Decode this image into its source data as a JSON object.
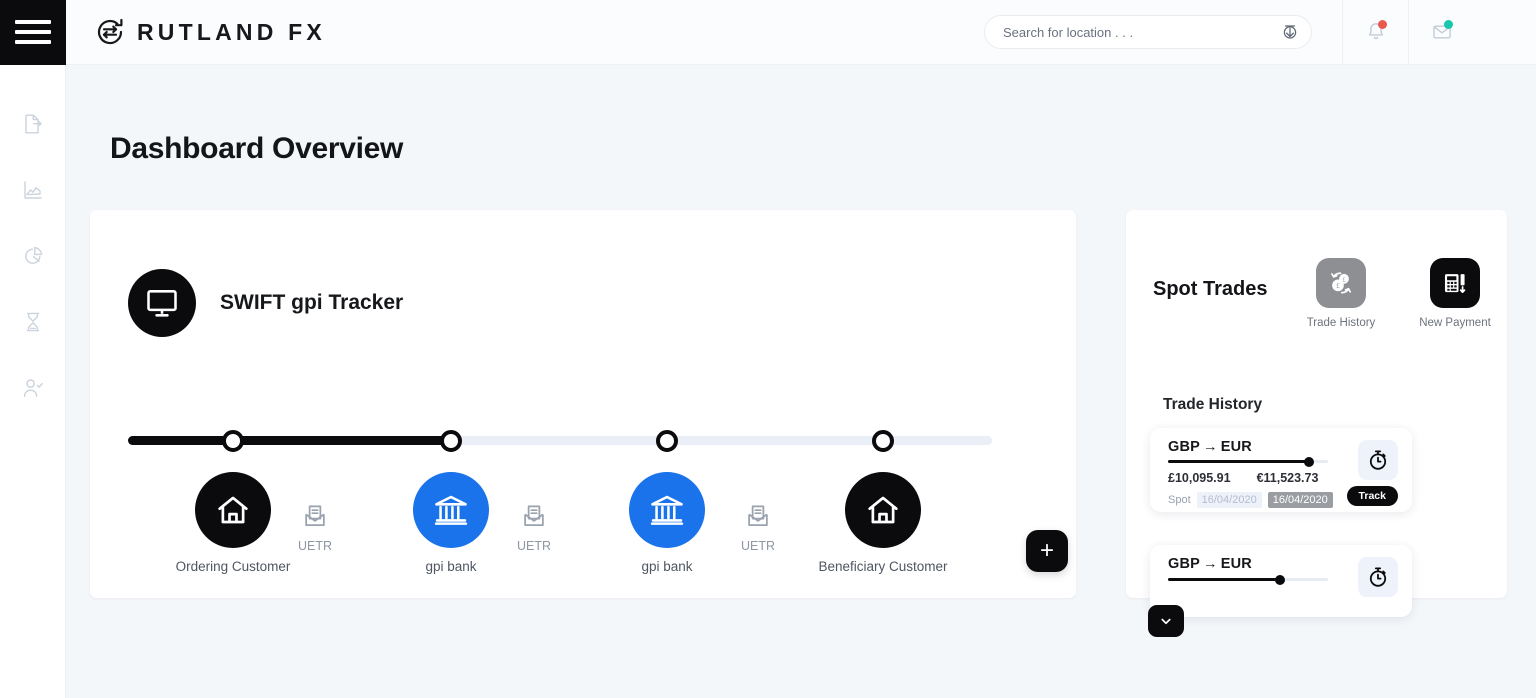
{
  "header": {
    "menu_icon": "hamburger-icon",
    "brand_name": "RUTLAND FX",
    "brand_icon": "exchange-circle-icon",
    "search": {
      "placeholder": "Search for location . . .",
      "value": "",
      "icon": "download-icon"
    },
    "notifications_icon": "bell-icon",
    "notifications_badge_color": "#e8584e",
    "messages_icon": "envelope-icon",
    "messages_badge_color": "#18c7ad"
  },
  "sidebar": {
    "items": [
      {
        "icon": "document-export-icon",
        "name": "sidebar-item-documents"
      },
      {
        "icon": "area-chart-icon",
        "name": "sidebar-item-analytics"
      },
      {
        "icon": "pie-chart-icon",
        "name": "sidebar-item-reports"
      },
      {
        "icon": "hourglass-icon",
        "name": "sidebar-item-pending"
      },
      {
        "icon": "user-check-icon",
        "name": "sidebar-item-clients"
      }
    ]
  },
  "page": {
    "title": "Dashboard Overview",
    "background_color": "#f4f7fa"
  },
  "swift_card": {
    "icon": "monitor-icon",
    "title": "SWIFT gpi Tracker",
    "progress_percent": 38,
    "add_button_label": "+",
    "stops": [
      {
        "label": "Ordering Customer",
        "icon": "home-icon",
        "style": "dark",
        "completed": true
      },
      {
        "label": "gpi bank",
        "icon": "bank-icon",
        "style": "blue",
        "completed": true
      },
      {
        "label": "gpi bank",
        "icon": "bank-icon",
        "style": "blue",
        "completed": false
      },
      {
        "label": "Beneficiary Customer",
        "icon": "home-icon",
        "style": "dark",
        "completed": false
      }
    ],
    "uetr_markers": [
      {
        "label": "UETR",
        "icon": "open-envelope-icon"
      },
      {
        "label": "UETR",
        "icon": "open-envelope-icon"
      },
      {
        "label": "UETR",
        "icon": "open-envelope-icon"
      }
    ]
  },
  "spot_panel": {
    "title": "Spot Trades",
    "actions": [
      {
        "label": "Trade History",
        "icon": "currency-exchange-icon",
        "tile_color": "#8d8f92"
      },
      {
        "label": "New Payment",
        "icon": "payment-terminal-icon",
        "tile_color": "#0b0b0d"
      }
    ],
    "section_label": "Trade History",
    "trades": [
      {
        "from_currency": "GBP",
        "arrow": "→",
        "to_currency": "EUR",
        "progress_percent": 88,
        "sell_amount": "£10,095.91",
        "buy_amount": "€11,523.73",
        "type_label": "Spot",
        "trade_date": "16/04/2020",
        "value_date": "16/04/2020",
        "timer_icon": "stopwatch-icon",
        "track_label": "Track"
      },
      {
        "from_currency": "GBP",
        "arrow": "→",
        "to_currency": "EUR",
        "progress_percent": 70,
        "timer_icon": "stopwatch-icon"
      }
    ],
    "expand_icon": "chevron-down-icon",
    "add_button_label": "+"
  }
}
